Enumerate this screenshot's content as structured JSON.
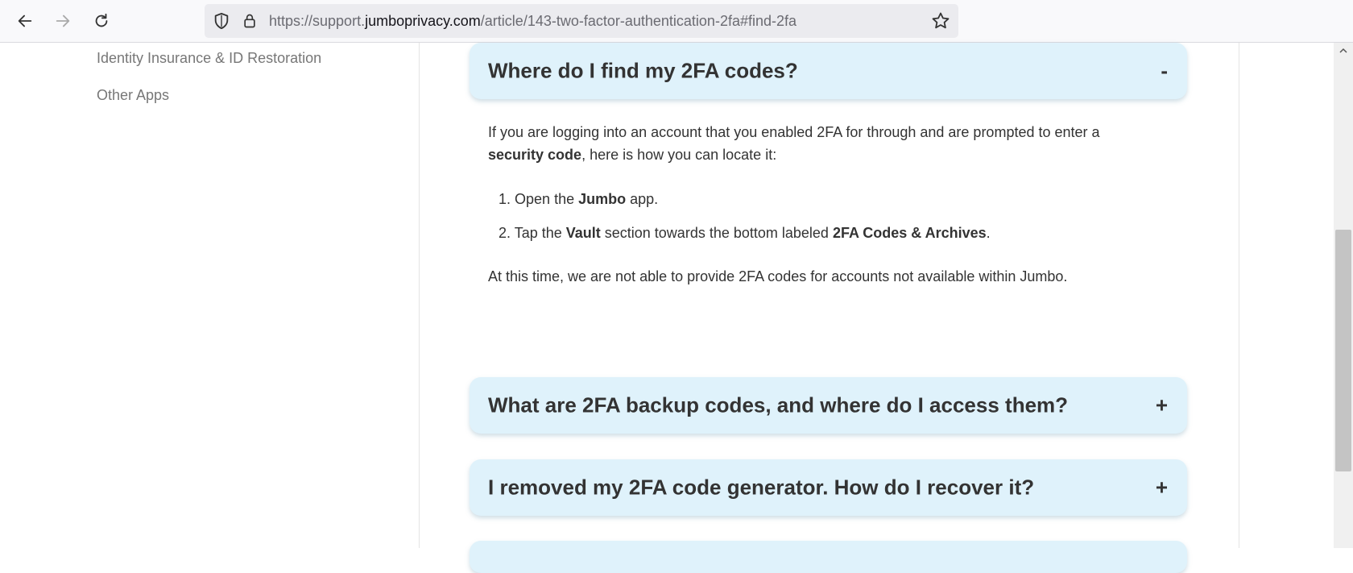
{
  "browser": {
    "url_prefix": "https://support.",
    "url_domain": "jumboprivacy.com",
    "url_path": "/article/143-two-factor-authentication-2fa#find-2fa"
  },
  "sidebar": {
    "items": [
      {
        "label": "Identity Insurance & ID Restoration"
      },
      {
        "label": "Other Apps"
      }
    ]
  },
  "faq": {
    "items": [
      {
        "question": "Where do I find my 2FA codes?",
        "toggle": "-"
      },
      {
        "question": "What are 2FA backup codes, and where do I access them?",
        "toggle": "+"
      },
      {
        "question": "I removed my 2FA code generator. How do I recover it?",
        "toggle": "+"
      }
    ],
    "answer": {
      "intro_part1": "If you are logging into an account that you enabled 2FA for through and are prompted to enter a",
      "intro_bold": "security code",
      "intro_part2": ", here is how you can locate it:",
      "step1_num": "1.",
      "step1_pre": "Open the ",
      "step1_bold": "Jumbo",
      "step1_post": " app.",
      "step2_num": "2.",
      "step2_pre": "Tap the ",
      "step2_bold1": "Vault",
      "step2_mid": " section towards the bottom labeled ",
      "step2_bold2": "2FA Codes & Archives",
      "step2_post": ".",
      "footer": "At this time, we are not able to provide 2FA codes for accounts not available within Jumbo."
    }
  }
}
